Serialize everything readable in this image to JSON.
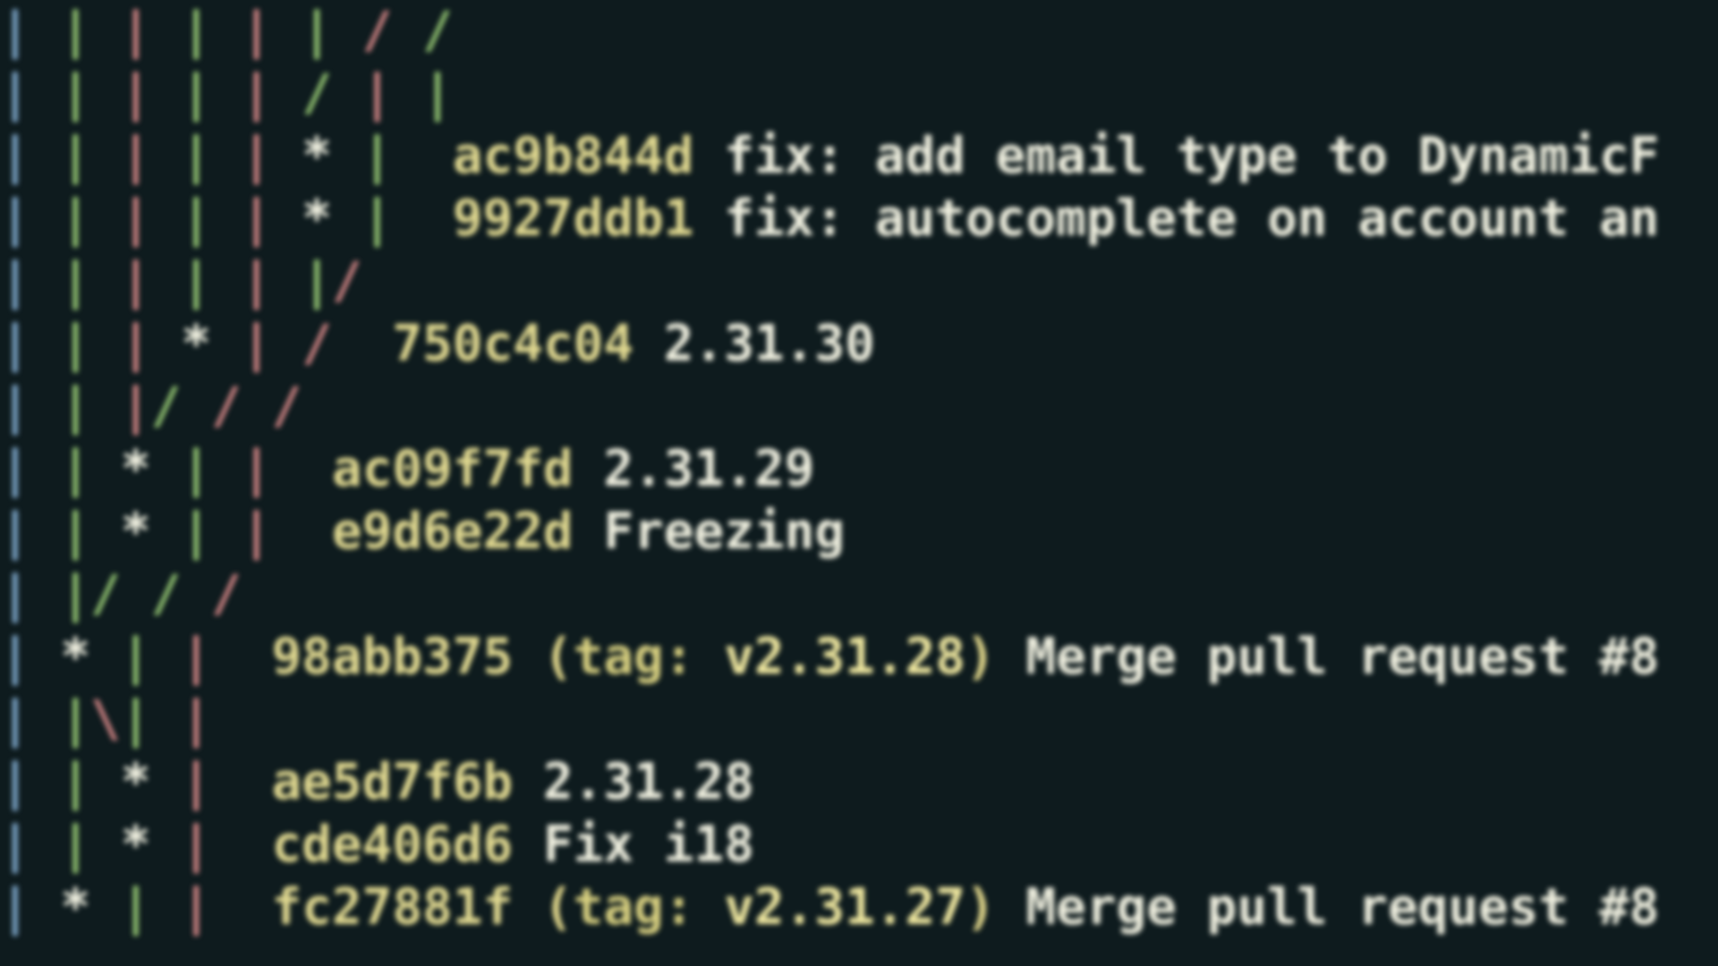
{
  "colors": {
    "blue": "#7aa2c4",
    "green": "#8fbf6f",
    "red": "#c98080",
    "white": "#f0f0e0",
    "yellow": "#e0d890",
    "bg": "#0e1b1e"
  },
  "lines": [
    {
      "graph": [
        [
          "b",
          "|"
        ],
        [
          " ",
          " "
        ],
        [
          "g",
          "|"
        ],
        [
          " ",
          " "
        ],
        [
          "r",
          "|"
        ],
        [
          " ",
          " "
        ],
        [
          "g",
          "|"
        ],
        [
          " ",
          " "
        ],
        [
          "r",
          "|"
        ],
        [
          " ",
          " "
        ],
        [
          "g",
          "|"
        ],
        [
          " ",
          " "
        ],
        [
          "r",
          "/"
        ],
        [
          " ",
          " "
        ],
        [
          "g",
          "/"
        ]
      ],
      "hash": "",
      "msg": ""
    },
    {
      "graph": [
        [
          "b",
          "|"
        ],
        [
          " ",
          " "
        ],
        [
          "g",
          "|"
        ],
        [
          " ",
          " "
        ],
        [
          "r",
          "|"
        ],
        [
          " ",
          " "
        ],
        [
          "g",
          "|"
        ],
        [
          " ",
          " "
        ],
        [
          "r",
          "|"
        ],
        [
          " ",
          " "
        ],
        [
          "g",
          "/"
        ],
        [
          " ",
          " "
        ],
        [
          "r",
          "|"
        ],
        [
          " ",
          " "
        ],
        [
          "g",
          "|"
        ]
      ],
      "hash": "",
      "msg": ""
    },
    {
      "graph": [
        [
          "b",
          "|"
        ],
        [
          " ",
          " "
        ],
        [
          "g",
          "|"
        ],
        [
          " ",
          " "
        ],
        [
          "r",
          "|"
        ],
        [
          " ",
          " "
        ],
        [
          "g",
          "|"
        ],
        [
          " ",
          " "
        ],
        [
          "r",
          "|"
        ],
        [
          " ",
          " "
        ],
        [
          "w",
          "*"
        ],
        [
          " ",
          " "
        ],
        [
          "g",
          "|"
        ],
        [
          " ",
          " "
        ]
      ],
      "hash": "ac9b844d",
      "msg": "fix: add email type to DynamicF"
    },
    {
      "graph": [
        [
          "b",
          "|"
        ],
        [
          " ",
          " "
        ],
        [
          "g",
          "|"
        ],
        [
          " ",
          " "
        ],
        [
          "r",
          "|"
        ],
        [
          " ",
          " "
        ],
        [
          "g",
          "|"
        ],
        [
          " ",
          " "
        ],
        [
          "r",
          "|"
        ],
        [
          " ",
          " "
        ],
        [
          "w",
          "*"
        ],
        [
          " ",
          " "
        ],
        [
          "g",
          "|"
        ],
        [
          " ",
          " "
        ]
      ],
      "hash": "9927ddb1",
      "msg": "fix: autocomplete on account an"
    },
    {
      "graph": [
        [
          "b",
          "|"
        ],
        [
          " ",
          " "
        ],
        [
          "g",
          "|"
        ],
        [
          " ",
          " "
        ],
        [
          "r",
          "|"
        ],
        [
          " ",
          " "
        ],
        [
          "g",
          "|"
        ],
        [
          " ",
          " "
        ],
        [
          "r",
          "|"
        ],
        [
          " ",
          " "
        ],
        [
          "g",
          "|"
        ],
        [
          "r",
          "/"
        ]
      ],
      "hash": "",
      "msg": ""
    },
    {
      "graph": [
        [
          "b",
          "|"
        ],
        [
          " ",
          " "
        ],
        [
          "g",
          "|"
        ],
        [
          " ",
          " "
        ],
        [
          "r",
          "|"
        ],
        [
          " ",
          " "
        ],
        [
          "w",
          "*"
        ],
        [
          " ",
          " "
        ],
        [
          "r",
          "|"
        ],
        [
          " ",
          " "
        ],
        [
          "r",
          "/"
        ],
        [
          " ",
          " "
        ]
      ],
      "hash": "750c4c04",
      "msg": "2.31.30"
    },
    {
      "graph": [
        [
          "b",
          "|"
        ],
        [
          " ",
          " "
        ],
        [
          "g",
          "|"
        ],
        [
          " ",
          " "
        ],
        [
          "r",
          "|"
        ],
        [
          "g",
          "/"
        ],
        [
          " ",
          " "
        ],
        [
          "r",
          "/"
        ],
        [
          " ",
          " "
        ],
        [
          "r",
          "/"
        ]
      ],
      "hash": "",
      "msg": ""
    },
    {
      "graph": [
        [
          "b",
          "|"
        ],
        [
          " ",
          " "
        ],
        [
          "g",
          "|"
        ],
        [
          " ",
          " "
        ],
        [
          "w",
          "*"
        ],
        [
          " ",
          " "
        ],
        [
          "g",
          "|"
        ],
        [
          " ",
          " "
        ],
        [
          "r",
          "|"
        ],
        [
          " ",
          " "
        ]
      ],
      "hash": "ac09f7fd",
      "msg": "2.31.29"
    },
    {
      "graph": [
        [
          "b",
          "|"
        ],
        [
          " ",
          " "
        ],
        [
          "g",
          "|"
        ],
        [
          " ",
          " "
        ],
        [
          "w",
          "*"
        ],
        [
          " ",
          " "
        ],
        [
          "g",
          "|"
        ],
        [
          " ",
          " "
        ],
        [
          "r",
          "|"
        ],
        [
          " ",
          " "
        ]
      ],
      "hash": "e9d6e22d",
      "msg": "Freezing"
    },
    {
      "graph": [
        [
          "b",
          "|"
        ],
        [
          " ",
          " "
        ],
        [
          "g",
          "|"
        ],
        [
          "g",
          "/"
        ],
        [
          " ",
          " "
        ],
        [
          "g",
          "/"
        ],
        [
          " ",
          " "
        ],
        [
          "r",
          "/"
        ]
      ],
      "hash": "",
      "msg": ""
    },
    {
      "graph": [
        [
          "b",
          "|"
        ],
        [
          " ",
          " "
        ],
        [
          "w",
          "*"
        ],
        [
          " ",
          " "
        ],
        [
          "g",
          "|"
        ],
        [
          " ",
          " "
        ],
        [
          "r",
          "|"
        ],
        [
          " ",
          " "
        ]
      ],
      "hash": "98abb375",
      "tag": "v2.31.28",
      "msg": "Merge pull request #8"
    },
    {
      "graph": [
        [
          "b",
          "|"
        ],
        [
          " ",
          " "
        ],
        [
          "g",
          "|"
        ],
        [
          "r",
          "\\"
        ],
        [
          "g",
          "|"
        ],
        [
          " ",
          " "
        ],
        [
          "r",
          "|"
        ]
      ],
      "hash": "",
      "msg": ""
    },
    {
      "graph": [
        [
          "b",
          "|"
        ],
        [
          " ",
          " "
        ],
        [
          "g",
          "|"
        ],
        [
          " ",
          " "
        ],
        [
          "w",
          "*"
        ],
        [
          " ",
          " "
        ],
        [
          "r",
          "|"
        ],
        [
          " ",
          " "
        ]
      ],
      "hash": "ae5d7f6b",
      "msg": "2.31.28"
    },
    {
      "graph": [
        [
          "b",
          "|"
        ],
        [
          " ",
          " "
        ],
        [
          "g",
          "|"
        ],
        [
          " ",
          " "
        ],
        [
          "w",
          "*"
        ],
        [
          " ",
          " "
        ],
        [
          "r",
          "|"
        ],
        [
          " ",
          " "
        ]
      ],
      "hash": "cde406d6",
      "msg": "Fix i18"
    },
    {
      "graph": [
        [
          "b",
          "|"
        ],
        [
          " ",
          " "
        ],
        [
          "w",
          "*"
        ],
        [
          " ",
          " "
        ],
        [
          "g",
          "|"
        ],
        [
          " ",
          " "
        ],
        [
          "r",
          "|"
        ],
        [
          " ",
          " "
        ]
      ],
      "hash": "fc27881f",
      "tag": "v2.31.27",
      "msg": "Merge pull request #8"
    }
  ],
  "tag_kw": "tag:"
}
